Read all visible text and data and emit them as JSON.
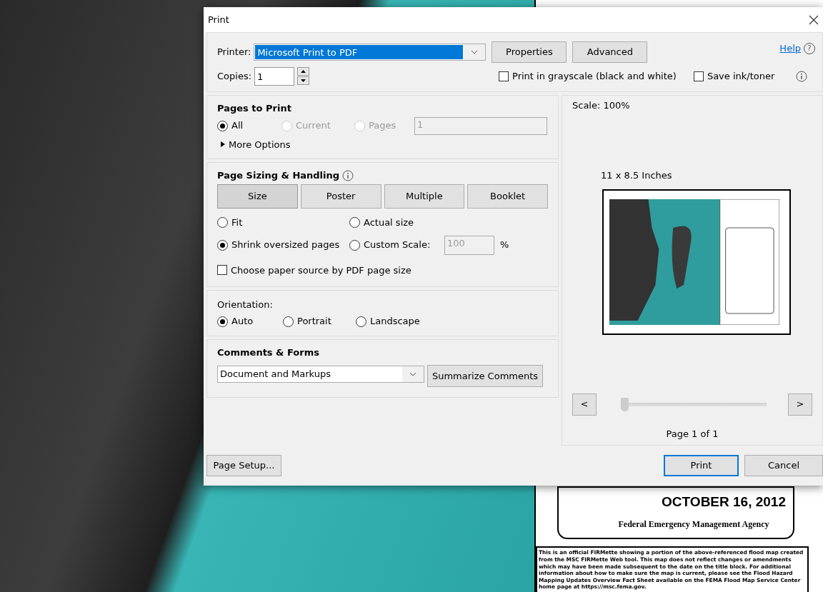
{
  "background": {
    "date": "OCTOBER 16, 2012",
    "agency": "Federal Emergency Management Agency",
    "note": "This is an official FIRMette showing a portion of the above-referenced flood map created from the MSC FIRMette Web tool.  This map does not reflect changes or amendments which may have been made subsequent to the date on the title block. For additional information about how to make sure the map is current, please see the Flood Hazard Mapping Updates Overview Fact Sheet available on the FEMA Flood Map Service Center home page at https://msc.fema.gov."
  },
  "dialog": {
    "title": "Print",
    "printer": {
      "label": "Printer:",
      "value": "Microsoft Print to PDF"
    },
    "top_buttons": [
      "Properties",
      "Advanced"
    ],
    "help": "Help",
    "help_icon": "?",
    "copies": {
      "label": "Copies:",
      "value": "1"
    },
    "options": [
      {
        "label": "Print in grayscale (black and white)",
        "checked": false
      },
      {
        "label": "Save ink/toner",
        "checked": false
      }
    ],
    "pages_to_print": {
      "title": "Pages to Print",
      "radios": [
        {
          "label": "All",
          "selected": true,
          "disabled": false
        },
        {
          "label": "Current",
          "selected": false,
          "disabled": true
        },
        {
          "label": "Pages",
          "selected": false,
          "disabled": true
        }
      ],
      "pages_value": "1",
      "more_options": "More Options",
      "expanded": false
    },
    "page_sizing": {
      "title": "Page Sizing & Handling",
      "tabs": [
        {
          "label": "Size",
          "selected": true
        },
        {
          "label": "Poster",
          "selected": false
        },
        {
          "label": "Multiple",
          "selected": false
        },
        {
          "label": "Booklet",
          "selected": false
        }
      ],
      "radios": [
        {
          "label": "Fit",
          "selected": false
        },
        {
          "label": "Actual size",
          "selected": false
        },
        {
          "label": "Shrink oversized pages",
          "selected": true
        },
        {
          "label": "Custom Scale:",
          "selected": false
        }
      ],
      "scale_value": "100",
      "percent": "%",
      "paper_source": {
        "label": "Choose paper source by PDF page size",
        "checked": false
      }
    },
    "orientation": {
      "title": "Orientation:",
      "radios": [
        {
          "label": "Auto",
          "selected": true
        },
        {
          "label": "Portrait",
          "selected": false
        },
        {
          "label": "Landscape",
          "selected": false
        }
      ]
    },
    "comments": {
      "title": "Comments & Forms",
      "value": "Document and Markups",
      "button": "Summarize Comments"
    },
    "preview": {
      "scale": "Scale: 100%",
      "size": "11 x 8.5 Inches",
      "prev": "<",
      "next": ">",
      "level": 0,
      "page": "Page 1 of 1"
    },
    "footer": {
      "page_setup": "Page Setup...",
      "print": "Print",
      "cancel": "Cancel"
    }
  }
}
